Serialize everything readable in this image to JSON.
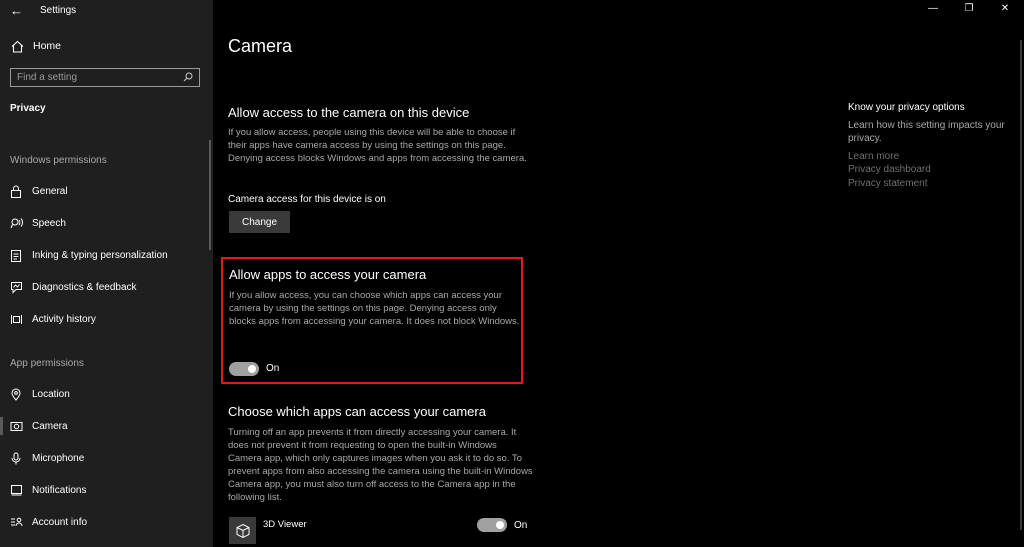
{
  "window": {
    "title": "Settings",
    "back_icon": "back-arrow-icon",
    "controls": [
      "minimize-icon",
      "restore-icon",
      "close-icon"
    ]
  },
  "sidebar": {
    "home_label": "Home",
    "search_placeholder": "Find a setting",
    "section_title": "Privacy",
    "windows_permissions_title": "Windows permissions",
    "windows_permissions": [
      {
        "label": "General",
        "icon": "lock-icon"
      },
      {
        "label": "Speech",
        "icon": "speech-icon"
      },
      {
        "label": "Inking & typing personalization",
        "icon": "clipboard-icon"
      },
      {
        "label": "Diagnostics & feedback",
        "icon": "diagnostics-icon"
      },
      {
        "label": "Activity history",
        "icon": "activity-icon"
      }
    ],
    "app_permissions_title": "App permissions",
    "app_permissions": [
      {
        "label": "Location",
        "icon": "location-icon"
      },
      {
        "label": "Camera",
        "icon": "camera-icon",
        "active": true
      },
      {
        "label": "Microphone",
        "icon": "microphone-icon"
      },
      {
        "label": "Notifications",
        "icon": "notifications-icon"
      },
      {
        "label": "Account info",
        "icon": "account-info-icon"
      }
    ]
  },
  "main": {
    "title": "Camera",
    "device_access": {
      "heading": "Allow access to the camera on this device",
      "description": "If you allow access, people using this device will be able to choose if their apps have camera access by using the settings on this page. Denying access blocks Windows and apps from accessing the camera.",
      "status": "Camera access for this device is on",
      "button_label": "Change"
    },
    "apps_access": {
      "heading": "Allow apps to access your camera",
      "description": "If you allow access, you can choose which apps can access your camera by using the settings on this page. Denying access only blocks apps from accessing your camera. It does not block Windows.",
      "toggle_label": "On",
      "highlight_color": "#e01919"
    },
    "choose_apps": {
      "heading": "Choose which apps can access your camera",
      "description": "Turning off an app prevents it from directly accessing your camera. It does not prevent it from requesting to open the built-in Windows Camera app, which only captures images when you ask it to do so. To prevent apps from also accessing the camera using the built-in Windows Camera app, you must also turn off access to the Camera app in the following list.",
      "apps": [
        {
          "name": "3D Viewer",
          "icon": "cube-icon",
          "toggle_label": "On"
        }
      ]
    }
  },
  "right_panel": {
    "title": "Know your privacy options",
    "description": "Learn how this setting impacts your privacy.",
    "links": [
      "Learn more",
      "Privacy dashboard",
      "Privacy statement"
    ]
  }
}
